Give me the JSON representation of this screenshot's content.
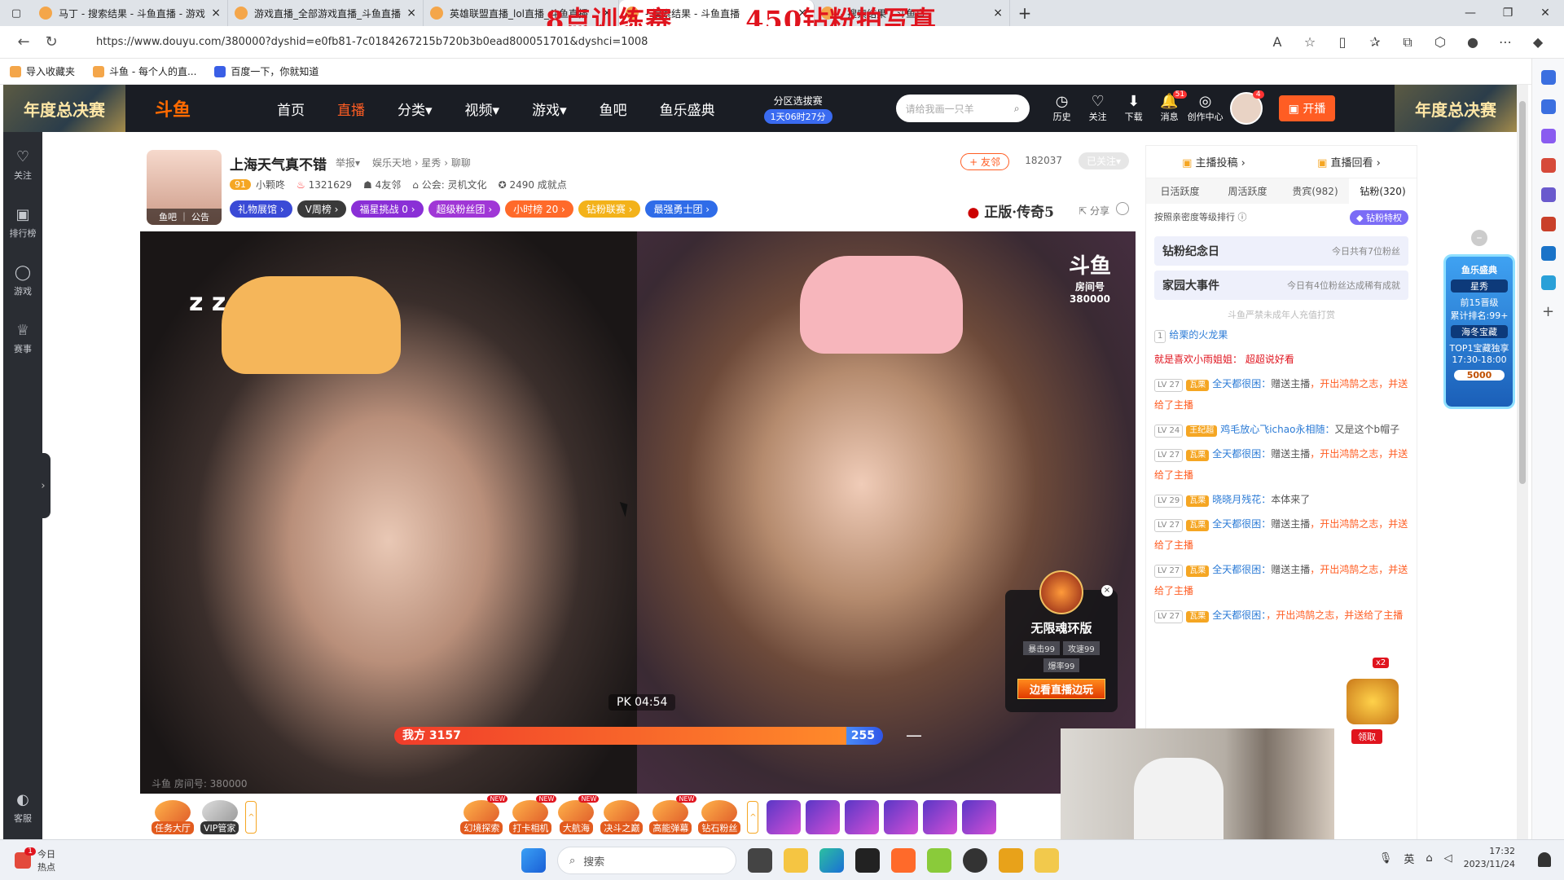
{
  "browser": {
    "tabs": [
      {
        "title": "马丁 - 搜索结果 - 斗鱼直播 - 游戏",
        "active": false
      },
      {
        "title": "游戏直播_全部游戏直播_斗鱼直播",
        "active": false
      },
      {
        "title": "英雄联盟直播_lol直播_斗鱼直播",
        "active": false
      },
      {
        "title": "- 搜索结果 - 斗鱼直播",
        "active": true
      },
      {
        "title": "- 搜索结果 - 斗鱼直",
        "active": false
      }
    ],
    "overlay_titles": [
      "8点训练赛",
      "450钻粉拍写真"
    ],
    "url": "https://www.douyu.com/380000?dyshid=e0fb81-7c0184267215b720b3b0ead800051701&dyshci=1008",
    "bookmarks": [
      "导入收藏夹",
      "斗鱼 - 每个人的直...",
      "百度一下，你就知道"
    ]
  },
  "header": {
    "banner_text": "年度总决赛",
    "logo": "斗鱼",
    "nav": [
      {
        "label": "首页",
        "active": false
      },
      {
        "label": "直播",
        "active": true
      },
      {
        "label": "分类▾",
        "active": false
      },
      {
        "label": "视频▾",
        "active": false
      },
      {
        "label": "游戏▾",
        "active": false
      },
      {
        "label": "鱼吧",
        "active": false
      },
      {
        "label": "鱼乐盛典",
        "active": false
      }
    ],
    "pick_title": "分区选拔赛",
    "pick_countdown": "1天06时27分",
    "search_placeholder": "请给我画一只羊",
    "icons": [
      {
        "label": "历史",
        "glyph": "◷"
      },
      {
        "label": "关注",
        "glyph": "♡"
      },
      {
        "label": "下载",
        "glyph": "⬇"
      },
      {
        "label": "消息",
        "glyph": "🔔"
      },
      {
        "label": "创作中心",
        "glyph": "◎"
      }
    ],
    "message_badge": "51",
    "avatar_badge": "4",
    "kaibo_label": "开播"
  },
  "left_rail": [
    {
      "label": "关注",
      "glyph": "♡"
    },
    {
      "label": "排行榜",
      "glyph": "▣"
    },
    {
      "label": "游戏",
      "glyph": "◯"
    },
    {
      "label": "赛事",
      "glyph": "♕"
    },
    {
      "label": "客服",
      "glyph": "◐"
    }
  ],
  "streamer": {
    "avatar_caption": "鱼吧 ｜ 公告",
    "title": "上海天气真不错",
    "report": "举报▾",
    "category": "娱乐天地 › 星秀 › 聊聊",
    "level": "91",
    "name": "小颗咚",
    "hot": "1321629",
    "friends": "4友邻",
    "guild": "公会: 灵机文化",
    "achievements": "2490 成就点",
    "badges": [
      {
        "label": "礼物展馆 ›",
        "color": "#3a4ad6"
      },
      {
        "label": "V周榜 ›",
        "color": "#3a3a3a"
      },
      {
        "label": "福星挑战 0 ›",
        "color": "#8a2fd6"
      },
      {
        "label": "超级粉丝团 ›",
        "color": "#a037d6"
      },
      {
        "label": "小时榜 20 ›",
        "color": "#ff6a2a"
      },
      {
        "label": "钻粉联赛 ›",
        "color": "#f3b21a"
      },
      {
        "label": "最强勇士团 ›",
        "color": "#2f6ce8"
      }
    ],
    "add_friend": "+ 友邻",
    "followers": "182037",
    "followed": "已关注▾",
    "ad": "正版·传奇5",
    "share": "分享"
  },
  "video": {
    "room_logo": "斗鱼",
    "room_label": "房间号",
    "room_id": "380000",
    "pk_time": "PK 04:54",
    "pk_left": "我方 3157",
    "pk_right": "255 对方",
    "pk_left_ratio": 0.925,
    "watermark": "斗鱼 房间号: 380000",
    "promo": {
      "name": "无限魂环版",
      "stats": [
        "暴击99",
        "攻速99",
        "爆率99"
      ],
      "button": "边看直播边玩"
    }
  },
  "giftbar": {
    "left": [
      "任务大厅",
      "VIP管家"
    ],
    "features": [
      {
        "label": "幻境探索",
        "new": true
      },
      {
        "label": "打卡相机",
        "new": true
      },
      {
        "label": "大航海",
        "new": true
      },
      {
        "label": "决斗之巅",
        "new": false
      },
      {
        "label": "高能弹幕",
        "new": true
      },
      {
        "label": "钻石粉丝",
        "new": false
      }
    ],
    "new_tag": "NEW",
    "gift_count": 6
  },
  "chat": {
    "top": [
      "主播投稿 ›",
      "直播回看 ›"
    ],
    "rank_tabs": [
      {
        "label": "日活跃度",
        "active": false
      },
      {
        "label": "周活跃度",
        "active": false
      },
      {
        "label": "贵宾(982)",
        "active": false
      },
      {
        "label": "钻粉(320)",
        "active": true
      }
    ],
    "sort_label": "按照亲密度等级排行",
    "fan_priv": "钻粉特权",
    "notices": [
      {
        "title": "钻粉纪念日",
        "desc": "今日共有7位粉丝"
      },
      {
        "title": "家园大事件",
        "desc": "今日有4位粉丝达成稀有成就"
      }
    ],
    "minor_tip": "斗鱼严禁未成年人充值打赏",
    "messages": [
      {
        "lv": "1",
        "tag": "",
        "nick": "给栗的火龙果",
        "text": "",
        "hl": ""
      },
      {
        "lv": "",
        "tag": "",
        "nick": "",
        "text": "",
        "hl": "就是喜欢小雨姐姐： 超超说好看"
      },
      {
        "lv": "LV 27",
        "tag": "瓦栗",
        "nick": "全天都很困：",
        "text": "赠送主播",
        "gift": "，开出鸿鹄之志，并送给了主播"
      },
      {
        "lv": "LV 24",
        "tag": "王纪超",
        "nick": "鸡毛放心飞ichao永相随：",
        "text": "又是这个b帽子",
        "gift": ""
      },
      {
        "lv": "LV 27",
        "tag": "瓦栗",
        "nick": "全天都很困：",
        "text": "赠送主播",
        "gift": "，开出鸿鹄之志，并送给了主播"
      },
      {
        "lv": "LV 29",
        "tag": "瓦栗",
        "nick": "晓晓月残花：",
        "text": "本体来了",
        "gift": ""
      },
      {
        "lv": "LV 27",
        "tag": "瓦栗",
        "nick": "全天都很困：",
        "text": "赠送主播",
        "gift": "，开出鸿鹄之志，并送给了主播"
      },
      {
        "lv": "LV 27",
        "tag": "瓦栗",
        "nick": "全天都很困：",
        "text": "赠送主播",
        "gift": "，开出鸿鹄之志，并送给了主播"
      },
      {
        "lv": "LV 27",
        "tag": "瓦栗",
        "nick": "全天都很困：",
        "text": "",
        "gift": "，开出鸿鹄之志，并送给了主播"
      }
    ],
    "claim": "领取",
    "multiplier": "x2"
  },
  "side_promo": {
    "title": "鱼乐盛典",
    "line1": "星秀",
    "line2": "前15晋级",
    "line3": "累计排名:99+",
    "line4": "海冬宝藏",
    "line5": "TOP1宝藏独享",
    "line6": "17:30-18:00",
    "value": "5000"
  },
  "taskbar": {
    "news_title": "今日",
    "news_sub": "热点",
    "news_badge": "1",
    "search": "搜索",
    "ime": "英",
    "time": "17:32",
    "date": "2023/11/24"
  },
  "colors": {
    "accent": "#ff5d23",
    "header_bg": "#1a1d24",
    "rail_bg": "#2a2d33"
  }
}
